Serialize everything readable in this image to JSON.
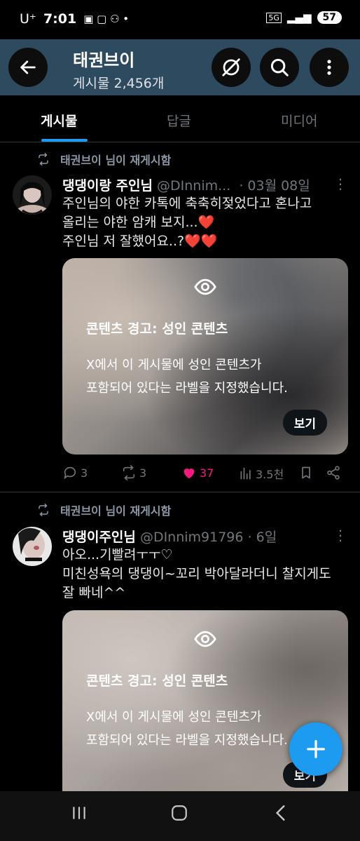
{
  "status_bar": {
    "carrier": "U⁺",
    "time": "7:01",
    "network": "5G",
    "battery": "57"
  },
  "header": {
    "title": "태권브이",
    "subtitle": "게시물 2,456개"
  },
  "tabs": [
    {
      "label": "게시물"
    },
    {
      "label": "답글"
    },
    {
      "label": "미디어"
    }
  ],
  "posts": [
    {
      "repost_label": "태권브이 님이 재게시함",
      "name": "댕댕이랑 주인님",
      "handle": "@DInnim...",
      "date": "· 03월 08일",
      "lines": [
        "주인님의 야한 카톡에 축축히젖었다고 혼나고",
        "올리는 야한 암캐 보지...❤️",
        "주인님 저 잘했어요..?❤️❤️"
      ],
      "media": {
        "warning_title": "콘텐츠 경고: 성인 콘텐츠",
        "warning_desc_1": "X에서 이 게시물에 성인 콘텐츠가",
        "warning_desc_2": "포함되어 있다는 라벨을 지정했습니다.",
        "button": "보기"
      },
      "actions": {
        "replies": "3",
        "reposts": "3",
        "likes": "37",
        "views": "3.5천"
      }
    },
    {
      "repost_label": "태권브이 님이 재게시함",
      "name": "댕댕이주인님",
      "handle": "@DInnim91796",
      "date": "· 6일",
      "lines": [
        "아오...기빨려ㅜㅜ♡",
        "미친성욕의 댕댕이~꼬리 박아달라더니 찰지게도",
        "잘 빠네^^"
      ],
      "media": {
        "warning_title": "콘텐츠 경고: 성인 콘텐츠",
        "warning_desc_1": "X에서 이 게시물에 성인 콘텐츠가",
        "warning_desc_2": "포함되어 있다는 라벨을 지정했습니다.",
        "button": "보기"
      }
    }
  ],
  "colors": {
    "accent": "#1d9bf0",
    "like": "#f91880",
    "header_bg": "#2e4a5f"
  }
}
